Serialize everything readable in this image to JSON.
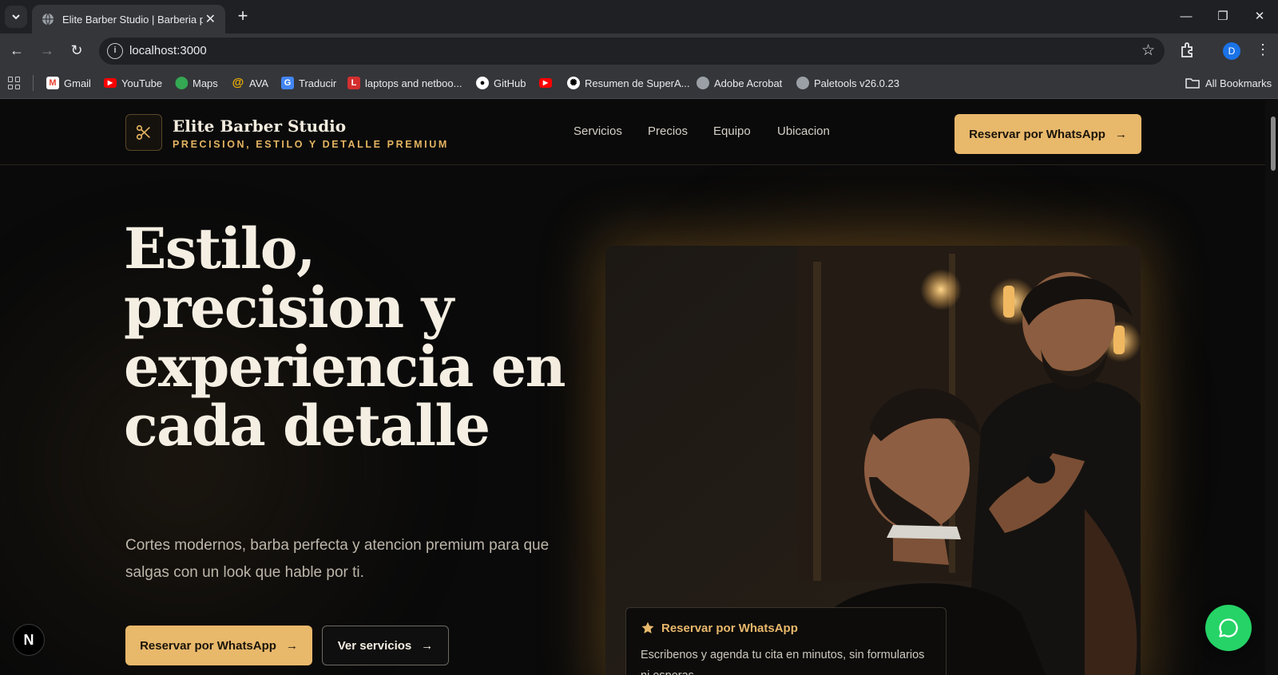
{
  "browser": {
    "tab_title": "Elite Barber Studio | Barberia pr",
    "url": "localhost:3000",
    "profile_initial": "D",
    "bookmarks": [
      {
        "label": "Gmail",
        "icon": "gmail-icon",
        "color": "#ea4335"
      },
      {
        "label": "YouTube",
        "icon": "youtube-icon",
        "color": "#ff0000"
      },
      {
        "label": "Maps",
        "icon": "maps-icon",
        "color": "#34a853"
      },
      {
        "label": "AVA",
        "icon": "at-icon",
        "color": "#f4b400"
      },
      {
        "label": "Traducir",
        "icon": "translate-icon",
        "color": "#4285f4"
      },
      {
        "label": "laptops and netboo...",
        "icon": "l-icon",
        "color": "#d32f2f"
      },
      {
        "label": "GitHub",
        "icon": "github-icon",
        "color": "#ffffff"
      },
      {
        "label": "",
        "icon": "youtube-icon",
        "color": "#ff0000"
      },
      {
        "label": "Resumen de SuperA...",
        "icon": "openai-icon",
        "color": "#ffffff"
      },
      {
        "label": "Adobe Acrobat",
        "icon": "globe-icon",
        "color": "#c6c8cc"
      },
      {
        "label": "Paletools v26.0.23",
        "icon": "globe-icon",
        "color": "#c6c8cc"
      }
    ],
    "all_bookmarks": "All Bookmarks"
  },
  "site": {
    "brand": "Elite Barber Studio",
    "tagline": "PRECISION, ESTILO Y DETALLE PREMIUM",
    "nav": [
      "Servicios",
      "Precios",
      "Equipo",
      "Ubicacion"
    ],
    "header_cta": "Reservar por WhatsApp",
    "hero_title": "Estilo, precision y experiencia en cada detalle",
    "hero_subtitle": "Cortes modernos, barba perfecta y atencion premium para que salgas con un look que hable por ti.",
    "primary_cta": "Reservar por WhatsApp",
    "secondary_cta": "Ver servicios",
    "card_title": "Reservar por WhatsApp",
    "card_text": "Escribenos y agenda tu cita en minutos, sin formularios ni esperas.",
    "accent": "#e8b86b",
    "whatsapp_color": "#25d366"
  }
}
